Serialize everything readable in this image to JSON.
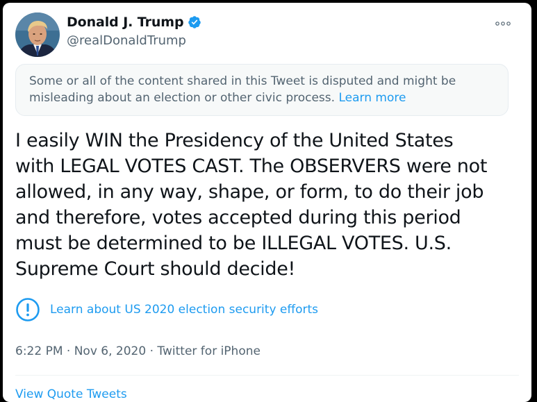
{
  "author": {
    "display_name": "Donald J. Trump",
    "handle": "@realDonaldTrump",
    "avatar_icon": "profile-photo",
    "verified_icon": "verified-badge-icon"
  },
  "notice": {
    "text": "Some or all of the content shared in this Tweet is disputed and might be misleading about an election or other civic process.",
    "link": "Learn more"
  },
  "tweet": {
    "lines": [
      "I easily WIN the Presidency of the United States",
      "with LEGAL VOTES CAST. The OBSERVERS were not",
      "allowed, in any way, shape, or form, to do their job",
      "and therefore, votes accepted during this period",
      "must be determined to be ILLEGAL VOTES. U.S.",
      "Supreme Court should decide!"
    ]
  },
  "election_link": {
    "icon": "exclamation-circle-icon",
    "label": "Learn about US 2020 election security efforts"
  },
  "meta": {
    "time": "6:22 PM",
    "separator": " · ",
    "date": "Nov 6, 2020",
    "source": "Twitter for iPhone"
  },
  "quote_tweets": {
    "label": "View Quote Tweets"
  },
  "colors": {
    "accent": "#1d9bf0",
    "text": "#0f1419",
    "secondary": "#536471",
    "notice_bg": "#f7f9f9"
  }
}
